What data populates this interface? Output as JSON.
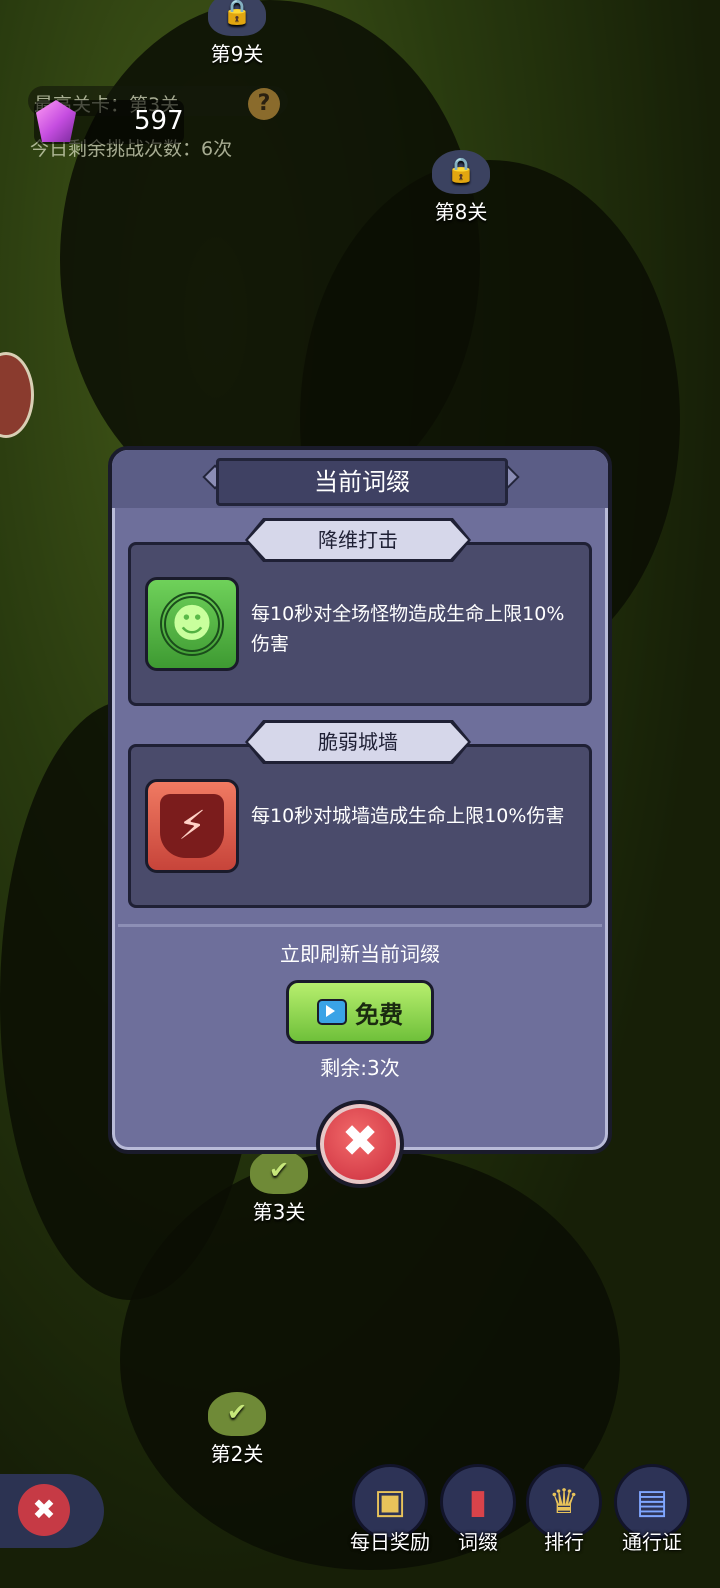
{
  "stages": {
    "s9": "第9关",
    "s8": "第8关",
    "s3": "第3关",
    "s2": "第2关"
  },
  "hud": {
    "highest_stage": "最高关卡：第3关",
    "daily_remaining": "今日剩余挑战次数：6次",
    "help": "?",
    "gem_count": "597"
  },
  "dialog": {
    "title": "当前词缀",
    "affixes": [
      {
        "name": "降维打击",
        "desc": "每10秒对全场怪物造成生命上限10%伤害",
        "icon": "green-figure-icon"
      },
      {
        "name": "脆弱城墙",
        "desc": "每10秒对城墙造成生命上限10%伤害",
        "icon": "cracked-shield-icon"
      }
    ],
    "refresh_text": "立即刷新当前词缀",
    "free_button": "免费",
    "remaining": "剩余:3次",
    "close": "✖"
  },
  "bottom_nav": {
    "back": "✖",
    "items": [
      {
        "label": "每日奖励",
        "icon": "treasure-chest-icon"
      },
      {
        "label": "词缀",
        "icon": "red-book-icon"
      },
      {
        "label": "排行",
        "icon": "trophy-icon"
      },
      {
        "label": "通行证",
        "icon": "pass-card-icon"
      }
    ]
  },
  "colors": {
    "dialog_bg": "#6e6f9b",
    "card_bg": "#4a4b6b",
    "free_button": "#8fd44c",
    "close_button": "#d6323f"
  }
}
